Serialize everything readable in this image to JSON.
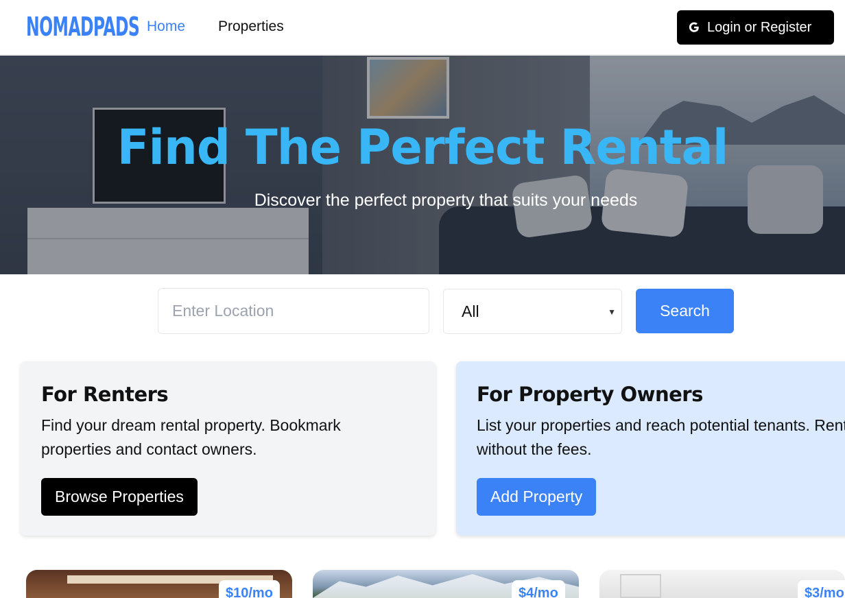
{
  "header": {
    "logo": "NOMADPADS",
    "nav": {
      "home": "Home",
      "properties": "Properties"
    },
    "login_label": "Login or Register"
  },
  "hero": {
    "title": "Find The Perfect Rental",
    "subtitle": "Discover the perfect property that suits your needs"
  },
  "search": {
    "location_placeholder": "Enter Location",
    "type_selected": "All",
    "button_label": "Search"
  },
  "cards": {
    "renters": {
      "title": "For Renters",
      "text": "Find your dream rental property. Bookmark properties and contact owners.",
      "button": "Browse Properties"
    },
    "owners": {
      "title": "For Property Owners",
      "text": "List your properties and reach potential tenants. Rent without the fees.",
      "button": "Add Property"
    }
  },
  "listings": [
    {
      "price": "$10/mo"
    },
    {
      "price": "$4/mo"
    },
    {
      "price": "$3/mo"
    }
  ],
  "colors": {
    "accent": "#3b82f6",
    "hero_title": "#38b6f5",
    "owners_card": "#dbeafe",
    "renters_card": "#f3f4f6"
  },
  "icons": {
    "login": "google-icon",
    "select": "chevron-down-icon"
  }
}
